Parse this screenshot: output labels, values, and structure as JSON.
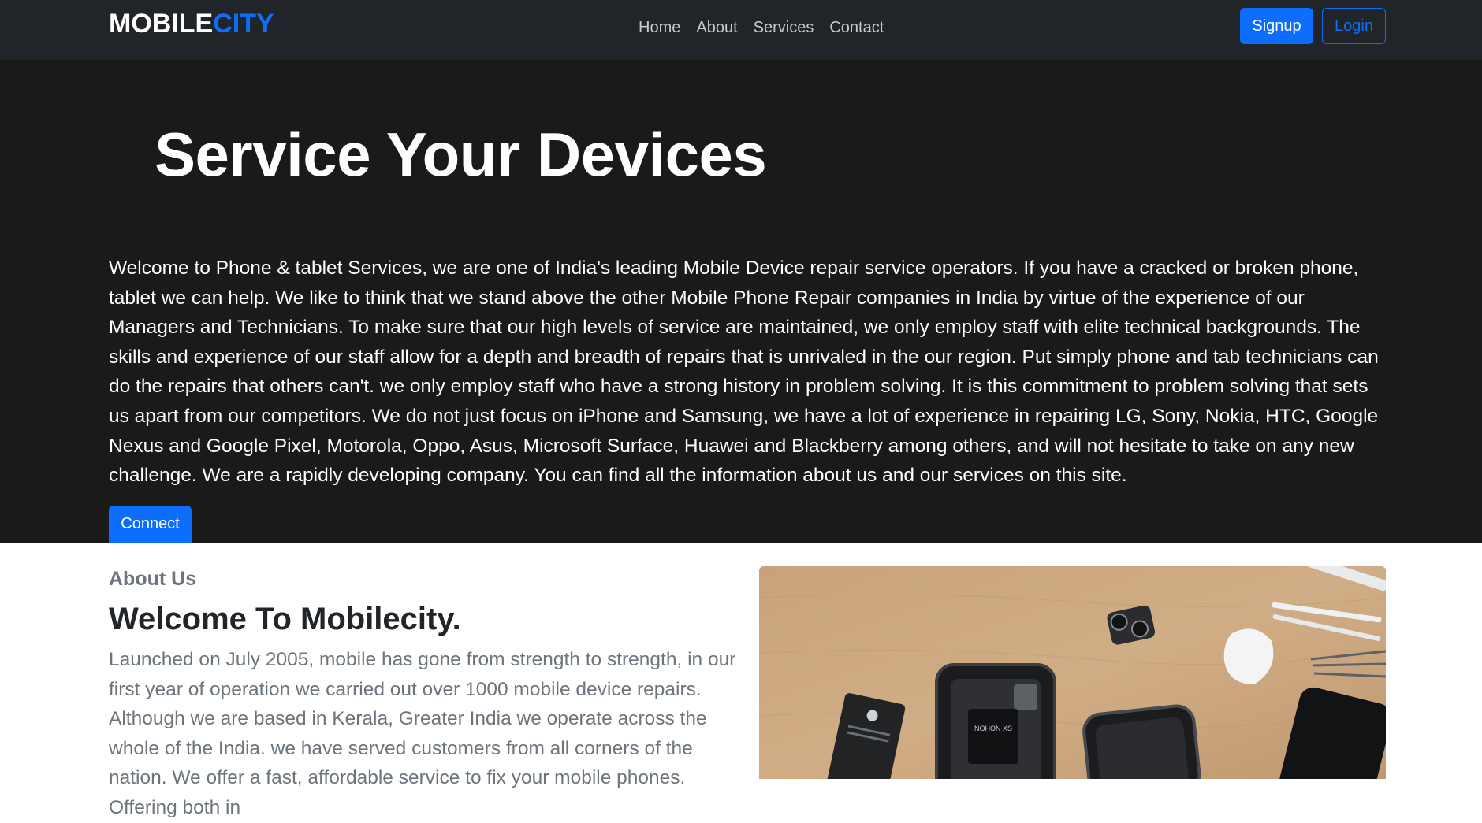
{
  "brand": {
    "main": "MOBILE",
    "accent": "CITY"
  },
  "nav": {
    "links": [
      "Home",
      "About",
      "Services",
      "Contact"
    ],
    "signup_label": "Signup",
    "login_label": "Login"
  },
  "hero": {
    "title": "Service Your Devices",
    "text": "Welcome to Phone & tablet Services, we are one of India's leading Mobile Device repair service operators. If you have a cracked or broken phone, tablet we can help. We like to think that we stand above the other Mobile Phone Repair companies in India by virtue of the experience of our Managers and Technicians. To make sure that our high levels of service are maintained, we only employ staff with elite technical backgrounds. The skills and experience of our staff allow for a depth and breadth of repairs that is unrivaled in the our region. Put simply phone and tab technicians can do the repairs that others can't. we only employ staff who have a strong history in problem solving. It is this commitment to problem solving that sets us apart from our competitors. We do not just focus on iPhone and Samsung, we have a lot of experience in repairing LG, Sony, Nokia, HTC, Google Nexus and Google Pixel, Motorola, Oppo, Asus, Microsoft Surface, Huawei and Blackberry among others, and will not hesitate to take on any new challenge. We are a rapidly developing company. You can find all the information about us and our services on this site.",
    "connect_label": "Connect"
  },
  "about": {
    "eyebrow": "About Us",
    "title": "Welcome To Mobilecity.",
    "text": "Launched on July 2005, mobile has gone from strength to strength, in our first year of operation we carried out over 1000 mobile device repairs. Although we are based in Kerala, Greater India we operate across the whole of the India. we have served customers from all corners of the nation. We offer a fast, affordable service to fix your mobile phones. Offering both in",
    "image_label": "NOHON XS"
  },
  "colors": {
    "primary": "#0d6efd",
    "navbar": "#212529",
    "hero": "#1c1a19",
    "muted": "#6c757d"
  }
}
